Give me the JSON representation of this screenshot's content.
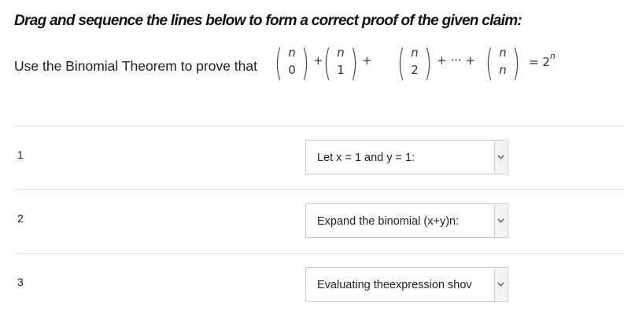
{
  "header": {
    "instruction": "Drag and sequence the lines below to form a correct proof of the given claim:"
  },
  "claim": {
    "prefix": "Use the Binomial Theorem to prove that",
    "terms": [
      {
        "top": "n",
        "bottom": "0"
      },
      {
        "top": "n",
        "bottom": "1"
      },
      {
        "top": "n",
        "bottom": "2"
      },
      {
        "top": "n",
        "bottom": "n"
      }
    ],
    "plus": "+",
    "ellipsis": "+ ··· +",
    "equals": "= 2",
    "exponent": "n"
  },
  "steps": [
    {
      "number": "1",
      "selected": "Let x = 1 and y = 1:"
    },
    {
      "number": "2",
      "selected": "Expand the binomial (x+y)n:"
    },
    {
      "number": "3",
      "selected": "Evaluating theexpression shov"
    }
  ],
  "icons": {
    "dropdown": "chevron-down-icon"
  }
}
